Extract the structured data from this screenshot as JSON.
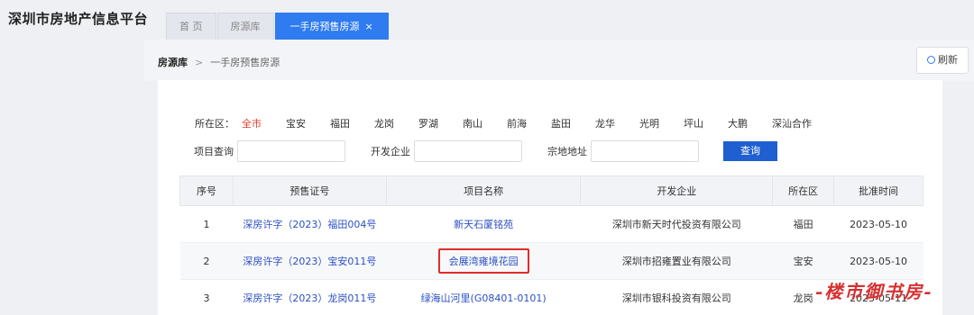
{
  "app": {
    "title": "深圳市房地产信息平台"
  },
  "tabs": [
    {
      "label": "首 页"
    },
    {
      "label": "房源库"
    },
    {
      "label": "一手房预售房源",
      "close": "×"
    }
  ],
  "breadcrumb": {
    "root": "房源库",
    "sep": ">",
    "current": "一手房预售房源"
  },
  "refresh_label": "刷新",
  "filter": {
    "district_label": "所在区：",
    "districts": [
      "全市",
      "宝安",
      "福田",
      "龙岗",
      "罗湖",
      "南山",
      "前海",
      "盐田",
      "龙华",
      "光明",
      "坪山",
      "大鹏",
      "深汕合作"
    ]
  },
  "search": {
    "project_label": "项目查询",
    "developer_label": "开发企业",
    "parcel_label": "宗地地址",
    "button": "查询"
  },
  "table": {
    "headers": [
      "序号",
      "预售证号",
      "项目名称",
      "开发企业",
      "所在区",
      "批准时间"
    ],
    "rows": [
      {
        "no": "1",
        "cert": "深房许字（2023）福田004号",
        "project": "新天石厦铭苑",
        "developer": "深圳市新天时代投资有限公司",
        "district": "福田",
        "date": "2023-05-10"
      },
      {
        "no": "2",
        "cert": "深房许字（2023）宝安011号",
        "project": "会展湾雍境花园",
        "developer": "深圳市招雍置业有限公司",
        "district": "宝安",
        "date": "2023-05-10"
      },
      {
        "no": "3",
        "cert": "深房许字（2023）龙岗011号",
        "project": "绿海山河里(G08401-0101)",
        "developer": "深圳市银科投资有限公司",
        "district": "龙岗",
        "date": "2023-05-11"
      }
    ]
  },
  "watermark": "-楼市御书房-"
}
